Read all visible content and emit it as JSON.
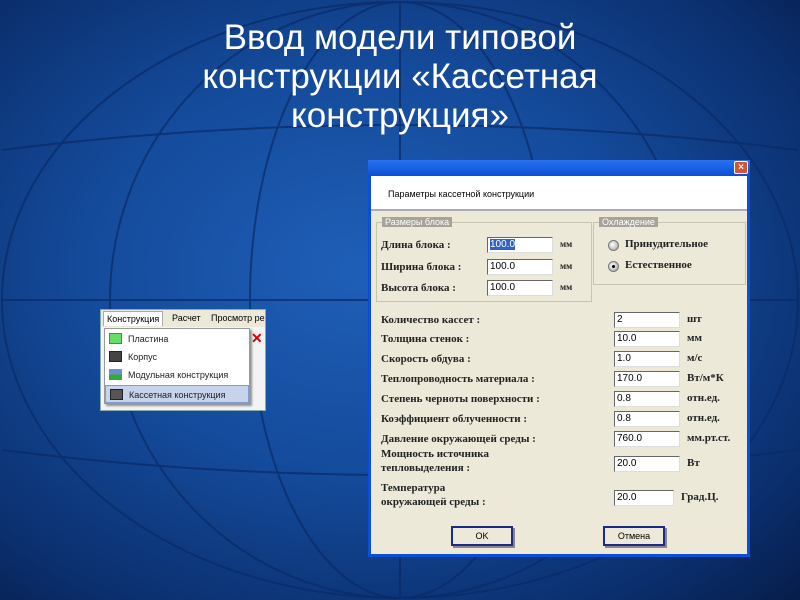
{
  "slide": {
    "title_line1": "Ввод модели типовой",
    "title_line2": "конструкции «Кассетная",
    "title_line3": "конструкция»"
  },
  "menu": {
    "bar": [
      "Конструкция",
      "Расчет",
      "Просмотр ре"
    ],
    "items": [
      {
        "label": "Пластина",
        "icon": "plate-icon"
      },
      {
        "label": "Корпус",
        "icon": "case-icon"
      },
      {
        "label": "Модульная конструкция",
        "icon": "modular-icon"
      },
      {
        "label": "Кассетная конструкция",
        "icon": "cassette-icon",
        "selected": true
      }
    ]
  },
  "dialog": {
    "header": "Параметры кассетной конструкции",
    "block_group": "Размеры блока",
    "block": [
      {
        "label": "Длина блока :",
        "value": "100.0",
        "unit": "мм"
      },
      {
        "label": "Ширина блока :",
        "value": "100.0",
        "unit": "мм"
      },
      {
        "label": "Высота блока :",
        "value": "100.0",
        "unit": "мм"
      }
    ],
    "cooling_group": "Охлаждение",
    "cooling": [
      {
        "label": "Принудительное",
        "selected": false
      },
      {
        "label": "Естественное",
        "selected": true
      }
    ],
    "params": [
      {
        "label": "Количество кассет :",
        "value": "2",
        "unit": "шт"
      },
      {
        "label": "Толщина стенок :",
        "value": "10.0",
        "unit": "мм"
      },
      {
        "label": "Скорость обдува :",
        "value": "1.0",
        "unit": "м/с"
      },
      {
        "label": "Теплопроводность материала :",
        "value": "170.0",
        "unit": "Вт/м*К"
      },
      {
        "label": "Степень черноты поверхности :",
        "value": "0.8",
        "unit": "отн.ед."
      },
      {
        "label": "Коэффициент облученности :",
        "value": "0.8",
        "unit": "отн.ед."
      },
      {
        "label": "Давление окружающей среды :",
        "value": "760.0",
        "unit": "мм.рт.ст."
      },
      {
        "label": "Мощность источника",
        "label2": "тепловыделения :",
        "value": "20.0",
        "unit": "Вт"
      },
      {
        "label": "Температура",
        "label2": "окружающей среды :",
        "value": "20.0",
        "unit": "Град.Ц."
      }
    ],
    "ok": "OK",
    "cancel": "Отмена"
  }
}
